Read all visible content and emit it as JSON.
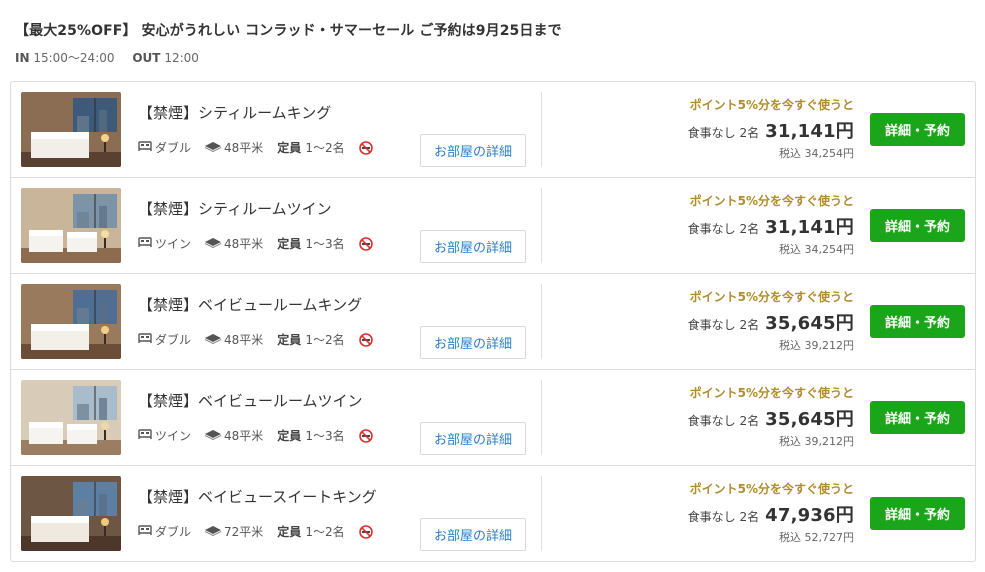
{
  "plan": {
    "title": "【最大25%OFF】 安心がうれしい コンラッド・サマーセール ご予約は9月25日まで",
    "checkin_label": "IN",
    "checkin_value": "15:00〜24:00",
    "checkout_label": "OUT",
    "checkout_value": "12:00"
  },
  "rooms": [
    {
      "name": "【禁煙】シティルームキング",
      "bed": "ダブル",
      "size": "48平米",
      "capacity_label": "定員",
      "capacity": "1〜2名",
      "detail_label": "お部屋の詳細",
      "points_promo": "ポイント5%分を今すぐ使うと",
      "meal": "食事なし 2名",
      "price": "31,141円",
      "tax_incl": "税込 34,254円",
      "book_label": "詳細・予約"
    },
    {
      "name": "【禁煙】シティルームツイン",
      "bed": "ツイン",
      "size": "48平米",
      "capacity_label": "定員",
      "capacity": "1〜3名",
      "detail_label": "お部屋の詳細",
      "points_promo": "ポイント5%分を今すぐ使うと",
      "meal": "食事なし 2名",
      "price": "31,141円",
      "tax_incl": "税込 34,254円",
      "book_label": "詳細・予約"
    },
    {
      "name": "【禁煙】ベイビュールームキング",
      "bed": "ダブル",
      "size": "48平米",
      "capacity_label": "定員",
      "capacity": "1〜2名",
      "detail_label": "お部屋の詳細",
      "points_promo": "ポイント5%分を今すぐ使うと",
      "meal": "食事なし 2名",
      "price": "35,645円",
      "tax_incl": "税込 39,212円",
      "book_label": "詳細・予約"
    },
    {
      "name": "【禁煙】ベイビュールームツイン",
      "bed": "ツイン",
      "size": "48平米",
      "capacity_label": "定員",
      "capacity": "1〜3名",
      "detail_label": "お部屋の詳細",
      "points_promo": "ポイント5%分を今すぐ使うと",
      "meal": "食事なし 2名",
      "price": "35,645円",
      "tax_incl": "税込 39,212円",
      "book_label": "詳細・予約"
    },
    {
      "name": "【禁煙】ベイビュースイートキング",
      "bed": "ダブル",
      "size": "72平米",
      "capacity_label": "定員",
      "capacity": "1〜2名",
      "detail_label": "お部屋の詳細",
      "points_promo": "ポイント5%分を今すぐ使うと",
      "meal": "食事なし 2名",
      "price": "47,936円",
      "tax_incl": "税込 52,727円",
      "book_label": "詳細・予約"
    }
  ],
  "icons": {
    "bed": "bed-icon",
    "size": "floor-area-icon",
    "no_smoking": "no-smoking-icon"
  },
  "colors": {
    "book_button": "#1aa51a",
    "detail_link": "#2a7fc9",
    "points_promo": "#b08d2c",
    "no_smoking": "#d9302c"
  }
}
